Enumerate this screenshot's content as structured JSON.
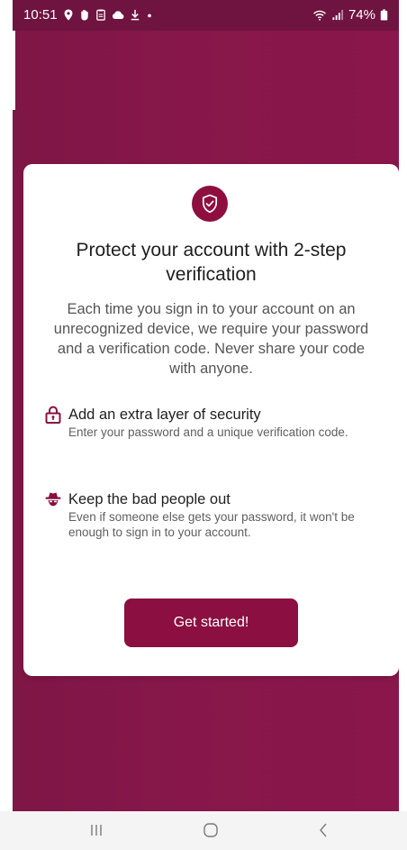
{
  "status_bar": {
    "time": "10:51",
    "battery": "74%",
    "left_icons": [
      "location-icon",
      "hand-icon",
      "clipboard-icon",
      "cloud-icon",
      "download-icon",
      "dot-icon"
    ],
    "right_icons": [
      "wifi-icon",
      "signal-icon",
      "battery-icon"
    ]
  },
  "card": {
    "icon": "shield-check-icon",
    "title": "Protect your account with 2-step verification",
    "intro": "Each time you sign in to your account on an unrecognized device, we require your password and a verification code. Never share your code with anyone.",
    "features": [
      {
        "icon": "lock-icon",
        "title": "Add an extra layer of security",
        "description": "Enter your password and a unique verification code."
      },
      {
        "icon": "spy-icon",
        "title": "Keep the bad people out",
        "description": "Even if someone else gets your password, it won't be enough to sign in to your account."
      }
    ],
    "button_label": "Get started!"
  },
  "nav_bar": {
    "buttons": [
      "recent-apps",
      "home",
      "back"
    ]
  },
  "colors": {
    "brand": "#8b0f40",
    "background": "#87174a",
    "status_bar": "#6f1340",
    "card": "#ffffff"
  }
}
